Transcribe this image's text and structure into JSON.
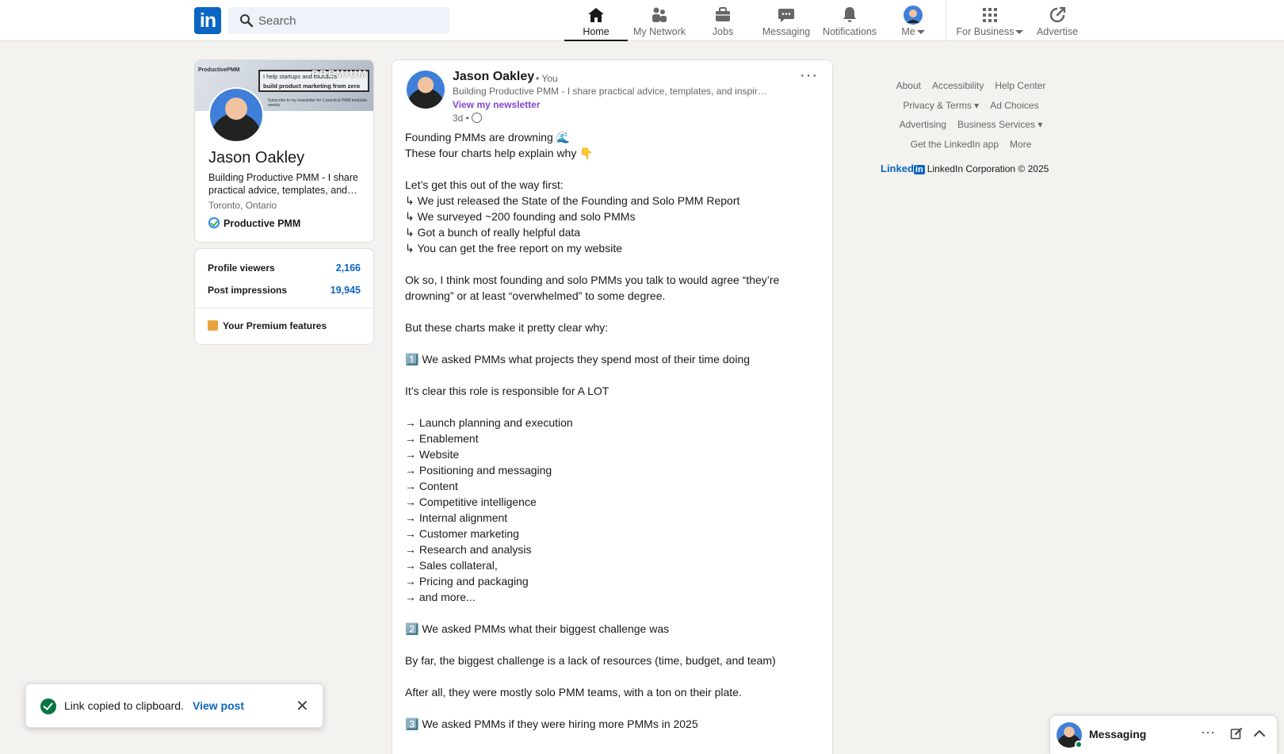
{
  "nav": {
    "logo": "in",
    "search_placeholder": "Search",
    "items": [
      {
        "label": "Home",
        "icon": "home-icon",
        "active": true
      },
      {
        "label": "My Network",
        "icon": "network-icon"
      },
      {
        "label": "Jobs",
        "icon": "briefcase-icon"
      },
      {
        "label": "Messaging",
        "icon": "messaging-icon"
      },
      {
        "label": "Notifications",
        "icon": "bell-icon"
      },
      {
        "label": "Me",
        "icon": "avatar"
      },
      {
        "label": "For Business",
        "icon": "grid-icon"
      },
      {
        "label": "Advertise",
        "icon": "advertise-icon"
      }
    ]
  },
  "profile": {
    "banner_brand": "ProductivePMM",
    "banner_premium": "PREMIUM",
    "banner_tag1": "I help startups and founders",
    "banner_tag2": "build product marketing from zero",
    "banner_subscribe": "Subscribe to my newsletter for 1 practical PMM template weekly",
    "name": "Jason Oakley",
    "headline": "Building Productive PMM - I share practical advice, templates, and…",
    "location": "Toronto, Ontario",
    "company": "Productive PMM"
  },
  "stats": {
    "viewers_label": "Profile viewers",
    "viewers_value": "2,166",
    "impressions_label": "Post impressions",
    "impressions_value": "19,945",
    "premium_label": "Your Premium features"
  },
  "post": {
    "author": "Jason Oakley",
    "you": "• You",
    "headline": "Building Productive PMM - I share practical advice, templates, and inspir…",
    "newsletter": "View my newsletter",
    "time": "3d •",
    "menu": "···",
    "lines": [
      "Founding PMMs are drowning 🌊",
      "These four charts help explain why 👇",
      "",
      "Let’s get this out of the way first:",
      "↳ We just released the State of the Founding and Solo PMM Report",
      "↳ We surveyed ~200 founding and solo PMMs",
      "↳ Got a bunch of really helpful data",
      "↳ You can get the free report on my website",
      "",
      "Ok so, I think most founding and solo PMMs you talk to would agree “they’re drowning” or at least “overwhelmed” to some degree.",
      "",
      "But these charts make it pretty clear why:",
      "",
      "1️⃣ We asked PMMs what projects they spend most of their time doing",
      "",
      "It’s clear this role is responsible for A LOT",
      "",
      "→ Launch planning and execution",
      "→ Enablement",
      "→ Website",
      "→ Positioning and messaging",
      "→ Content",
      "→ Competitive intelligence",
      "→ Internal alignment",
      "→ Customer marketing",
      "→ Research and analysis",
      "→ Sales collateral,",
      "→ Pricing and packaging",
      "→ and more...",
      "",
      "2️⃣ We asked PMMs what their biggest challenge was",
      "",
      "By far, the biggest challenge is a lack of resources (time, budget, and team)",
      "",
      "After all, they were mostly solo PMM teams, with a ton on their plate.",
      "",
      "3️⃣ We asked PMMs if they were hiring more PMMs in 2025"
    ]
  },
  "footer": {
    "links": [
      "About",
      "Accessibility",
      "Help Center",
      "Privacy & Terms ▾",
      "Ad Choices",
      "Advertising",
      "Business Services ▾",
      "Get the LinkedIn app",
      "More"
    ],
    "brand": "Linked",
    "brand_box": "in",
    "copyright": "LinkedIn Corporation © 2025"
  },
  "toast": {
    "message": "Link copied to clipboard.",
    "link": "View post",
    "close": "✕"
  },
  "messaging": {
    "title": "Messaging",
    "dots": "···"
  }
}
